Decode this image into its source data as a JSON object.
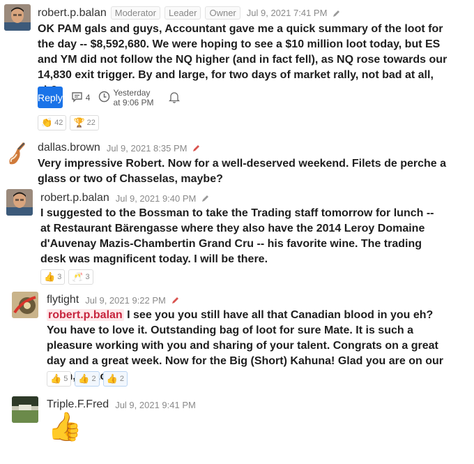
{
  "posts": [
    {
      "author": "robert.p.balan",
      "badges": [
        "Moderator",
        "Leader",
        "Owner"
      ],
      "time": "Jul 9, 2021 7:41 PM",
      "body": "OK PAM gals and guys, Accountant gave me a quick summary of the loot for the day -- $8,592,680. We were hoping to see a $10 million loot today, but ES and YM did not follow the NQ higher (and in fact fell), as NQ rose towards our 14,830 exit trigger. By and large, for two days of market rally, not bad at all, eh?",
      "reply_label": "Reply",
      "comment_count": "4",
      "last_activity": "Yesterday at 9:06 PM",
      "reactions": [
        {
          "icon": "clap-icon",
          "glyph": "👏",
          "count": "42"
        },
        {
          "icon": "trophy-icon",
          "glyph": "🏆",
          "count": "22"
        }
      ]
    },
    {
      "author": "dallas.brown",
      "time": "Jul 9, 2021 8:35 PM",
      "body": "Very impressive Robert. Now for a well-deserved weekend. Filets de perche a glass or two of Chasselas, maybe?"
    },
    {
      "author": "robert.p.balan",
      "time": "Jul 9, 2021 9:40 PM",
      "body": "I suggested to the Bossman to take the Trading staff tomorrow for lunch -- at Restaurant Bärengasse where they also have the 2014 Leroy Domaine d'Auvenay Mazis-Chambertin Grand Cru -- his favorite wine. The trading desk was magnificent today. I will be there.",
      "reactions": [
        {
          "icon": "thumbs-up-icon",
          "glyph": "👍",
          "count": "3"
        },
        {
          "icon": "champagne-icon",
          "glyph": "🥂",
          "count": "3"
        }
      ]
    },
    {
      "author": "flytight",
      "time": "Jul 9, 2021 9:22 PM",
      "mention": "robert.p.balan",
      "body": " I see you you still have all that Canadian blood in you eh? You have to love it. Outstanding bag of loot for sure Mate. It is such a pleasure working with you and sharing of your talent. Congrats on a great day and a great week. Now for the Big (Short) Kahuna! Glad you are on our team, Coach.",
      "reactions": [
        {
          "icon": "thumbs-up-icon",
          "glyph": "👍",
          "count": "5"
        },
        {
          "icon": "thumbs-up-icon",
          "glyph": "👍",
          "count": "2"
        },
        {
          "icon": "thumbs-up-icon",
          "glyph": "👍",
          "count": "2"
        }
      ]
    },
    {
      "author": "Triple.F.Fred",
      "time": "Jul 9, 2021 9:41 PM",
      "big_emoji": "👍"
    }
  ],
  "colors": {
    "reply": "#1a73e8",
    "mention_bg": "#fde8ea",
    "mention_text": "#c7253e",
    "edit_red": "#d9534f",
    "edit_gray": "#999999"
  }
}
